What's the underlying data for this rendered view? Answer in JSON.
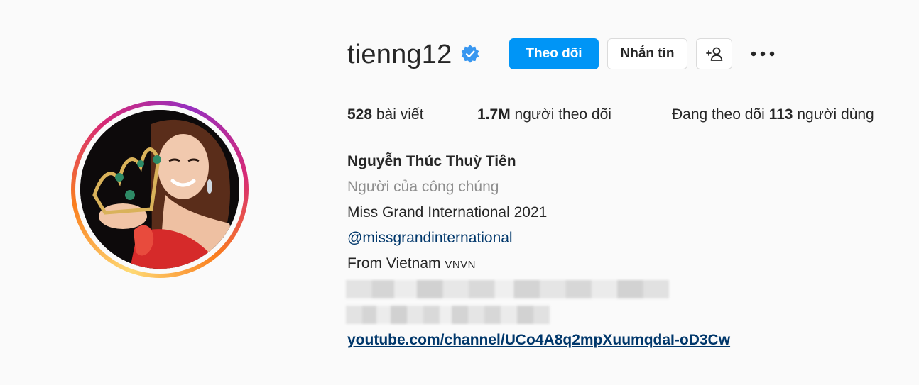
{
  "profile": {
    "username": "tienng12",
    "verified": true,
    "follow_label": "Theo dõi",
    "message_label": "Nhắn tin",
    "suggest_icon": "person-plus-icon",
    "more_icon": "ellipsis-icon"
  },
  "stats": {
    "posts_count": "528",
    "posts_label": " bài viết",
    "followers_count": "1.7M",
    "followers_label": " người theo dõi",
    "following_prefix": "Đang theo dõi ",
    "following_count": "113",
    "following_label": " người dùng"
  },
  "bio": {
    "full_name": "Nguyễn Thúc Thuỳ Tiên",
    "category": "Người của công chúng",
    "title": "Miss Grand International 2021",
    "mention": "@missgrandinternational",
    "from_text": "From Vietnam ",
    "flags": "VNVN",
    "link": "youtube.com/channel/UCo4A8q2mpXuumqdaI-oD3Cw"
  },
  "colors": {
    "accent": "#0095f6",
    "link": "#00376b",
    "muted": "#8e8e8e",
    "text": "#262626",
    "verified": "#3897f0"
  }
}
